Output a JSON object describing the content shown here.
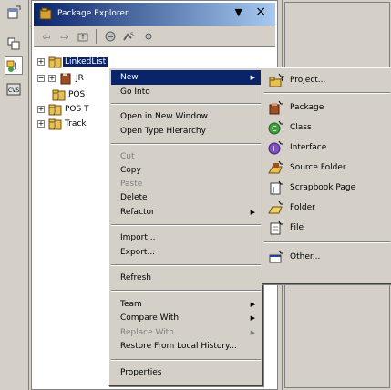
{
  "view": {
    "title": "Package Explorer",
    "menu_arrow": "▼",
    "close": "×"
  },
  "tree": [
    {
      "label": "LinkedList",
      "selected": true,
      "expander": "+"
    },
    {
      "label": "JR",
      "selected": false,
      "expander": "−"
    },
    {
      "label": "POS",
      "selected": false,
      "expander": ""
    },
    {
      "label": "POS T",
      "selected": false,
      "expander": "+"
    },
    {
      "label": "Track",
      "selected": false,
      "expander": "+"
    }
  ],
  "context_menu": {
    "items": [
      {
        "label": "New",
        "state": "highlight",
        "submenu": true
      },
      {
        "label": "Go Into"
      },
      {
        "label": "Open in New Window"
      },
      {
        "label": "Open Type Hierarchy"
      },
      {
        "label": "Cut",
        "state": "disabled"
      },
      {
        "label": "Copy"
      },
      {
        "label": "Paste",
        "state": "disabled"
      },
      {
        "label": "Delete"
      },
      {
        "label": "Refactor",
        "submenu": true
      },
      {
        "label": "Import..."
      },
      {
        "label": "Export..."
      },
      {
        "label": "Refresh"
      },
      {
        "label": "Team",
        "submenu": true
      },
      {
        "label": "Compare With",
        "submenu": true
      },
      {
        "label": "Replace With",
        "state": "disabled",
        "submenu": true
      },
      {
        "label": "Restore From Local History..."
      },
      {
        "label": "Properties"
      }
    ]
  },
  "new_submenu": {
    "items": [
      {
        "label": "Project...",
        "icon": "project-wizard-icon"
      },
      {
        "label": "Package",
        "icon": "package-wizard-icon"
      },
      {
        "label": "Class",
        "icon": "class-wizard-icon"
      },
      {
        "label": "Interface",
        "icon": "interface-wizard-icon"
      },
      {
        "label": "Source Folder",
        "icon": "source-folder-wizard-icon"
      },
      {
        "label": "Scrapbook Page",
        "icon": "scrapbook-wizard-icon"
      },
      {
        "label": "Folder",
        "icon": "folder-wizard-icon"
      },
      {
        "label": "File",
        "icon": "file-wizard-icon"
      },
      {
        "label": "Other...",
        "icon": "other-wizard-icon"
      }
    ]
  }
}
